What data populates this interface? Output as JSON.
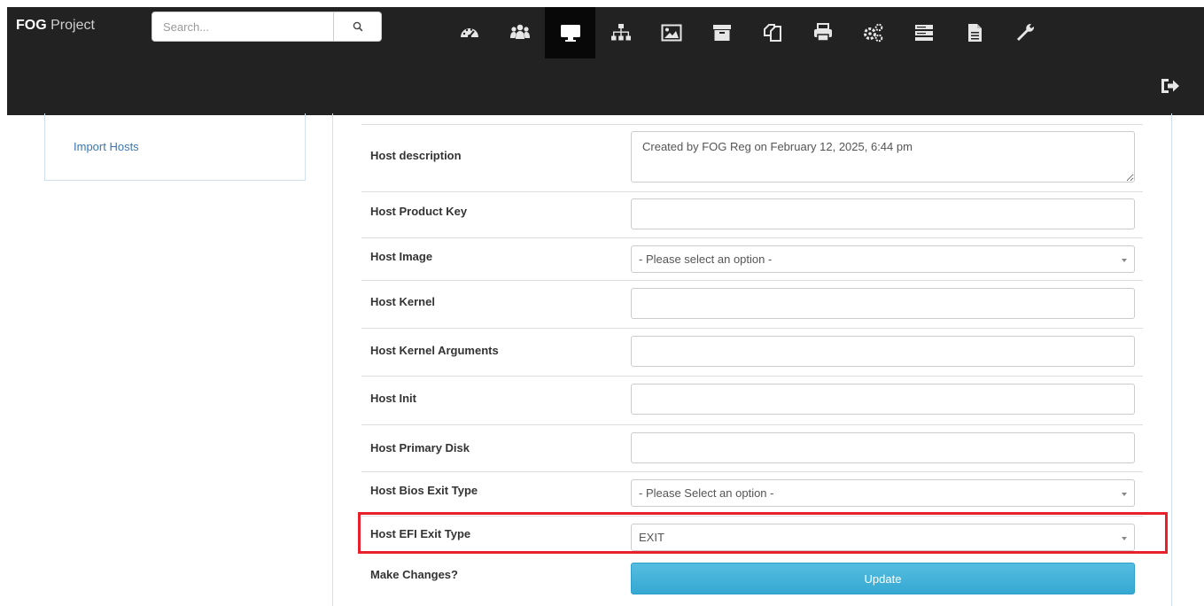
{
  "brand": {
    "bold": "FOG",
    "rest": " Project"
  },
  "search": {
    "placeholder": "Search..."
  },
  "nav": {
    "icons": [
      "dashboard-icon",
      "users-icon",
      "hosts-icon",
      "groups-icon",
      "images-icon",
      "storage-icon",
      "snapins-icon",
      "printers-icon",
      "service-icon",
      "tasks-icon",
      "reports-icon",
      "settings-icon"
    ],
    "active": "hosts-icon",
    "logout_icon": "logout-icon"
  },
  "sidebar": {
    "import_hosts": "Import Hosts"
  },
  "form": {
    "host_description": {
      "label": "Host description",
      "value": "Created by FOG Reg on February 12, 2025, 6:44 pm"
    },
    "host_product_key": {
      "label": "Host Product Key",
      "value": ""
    },
    "host_image": {
      "label": "Host Image",
      "selected": "- Please select an option -"
    },
    "host_kernel": {
      "label": "Host Kernel",
      "value": ""
    },
    "host_kernel_args": {
      "label": "Host Kernel Arguments",
      "value": ""
    },
    "host_init": {
      "label": "Host Init",
      "value": ""
    },
    "host_primary_disk": {
      "label": "Host Primary Disk",
      "value": ""
    },
    "host_bios_exit": {
      "label": "Host Bios Exit Type",
      "selected": "- Please Select an option -"
    },
    "host_efi_exit": {
      "label": "Host EFI Exit Type",
      "selected": "EXIT"
    },
    "make_changes": {
      "label": "Make Changes?",
      "button": "Update"
    }
  },
  "colors": {
    "navbar": "#222222",
    "link": "#3a78b5",
    "button": "#40b0d8",
    "highlight": "#e8202c"
  }
}
